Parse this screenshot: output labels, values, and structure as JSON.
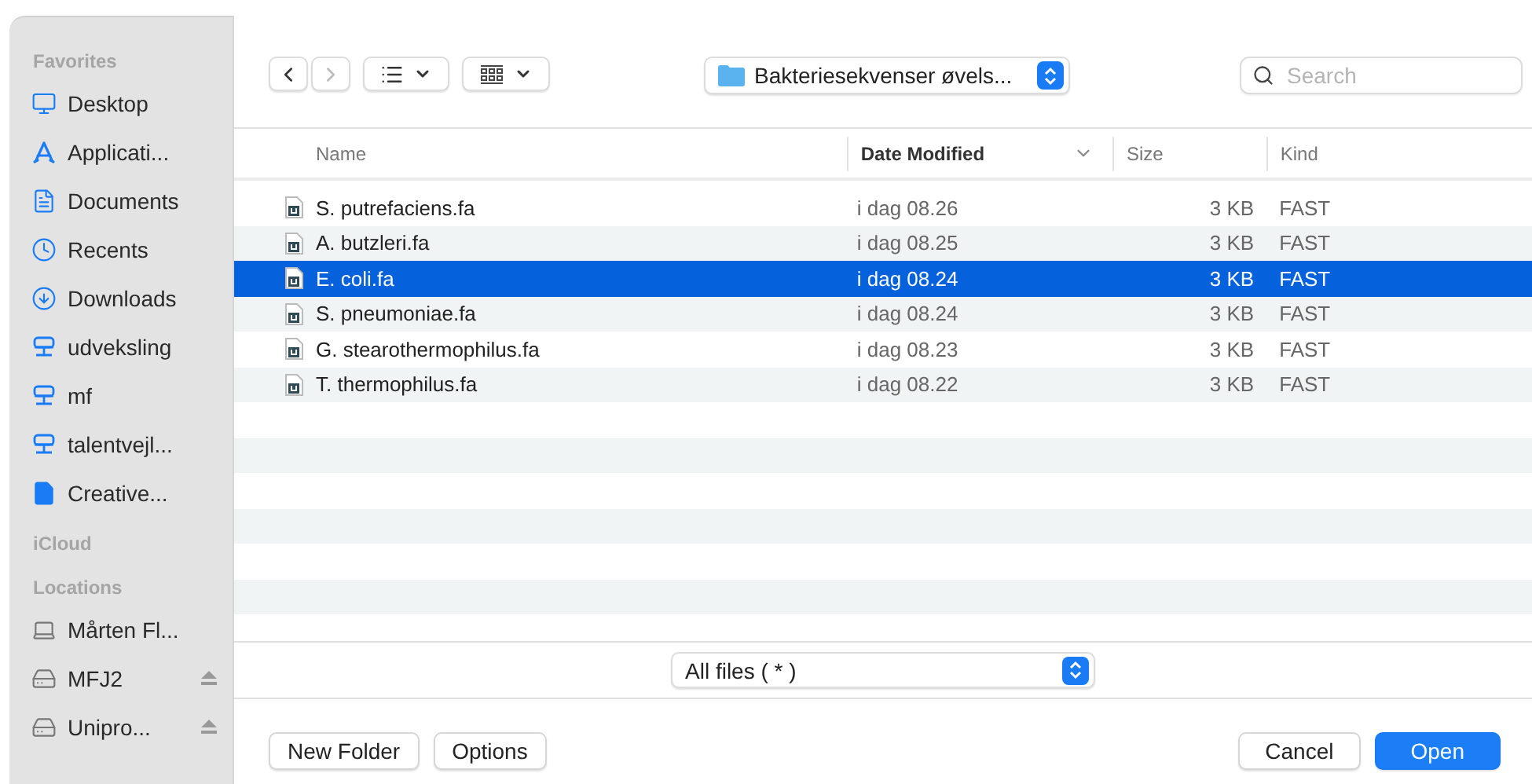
{
  "sidebar": {
    "sections": [
      {
        "title": "Favorites",
        "items": [
          {
            "label": "Desktop",
            "kind": "desktop"
          },
          {
            "label": "Applicati...",
            "kind": "apps"
          },
          {
            "label": "Documents",
            "kind": "document"
          },
          {
            "label": "Recents",
            "kind": "clock"
          },
          {
            "label": "Downloads",
            "kind": "download"
          },
          {
            "label": "udveksling",
            "kind": "server"
          },
          {
            "label": "mf",
            "kind": "server"
          },
          {
            "label": "talentvejl...",
            "kind": "server"
          },
          {
            "label": "Creative...",
            "kind": "file"
          }
        ]
      },
      {
        "title": "iCloud"
      },
      {
        "title": "Locations",
        "items": [
          {
            "label": "Mårten Fl...",
            "kind": "computer",
            "ejectable": false
          },
          {
            "label": "MFJ2",
            "kind": "disk",
            "ejectable": true
          },
          {
            "label": "Unipro...",
            "kind": "disk",
            "ejectable": true
          }
        ]
      }
    ]
  },
  "toolbar": {
    "location": "Bakteriesekvenser øvels...",
    "search": {
      "placeholder": "Search"
    }
  },
  "table": {
    "columns": [
      {
        "label": "Name",
        "sorted": false
      },
      {
        "label": "Date Modified",
        "sorted": true
      },
      {
        "label": "Size",
        "sorted": false
      },
      {
        "label": "Kind",
        "sorted": false
      }
    ],
    "rows": [
      {
        "name": "S. putrefaciens.fa",
        "date": "i dag 08.26",
        "size": "3 KB",
        "kind": "FAST",
        "selected": false
      },
      {
        "name": "A. butzleri.fa",
        "date": "i dag 08.25",
        "size": "3 KB",
        "kind": "FAST",
        "selected": false
      },
      {
        "name": "E. coli.fa",
        "date": "i dag 08.24",
        "size": "3 KB",
        "kind": "FAST",
        "selected": true
      },
      {
        "name": "S. pneumoniae.fa",
        "date": "i dag 08.24",
        "size": "3 KB",
        "kind": "FAST",
        "selected": false
      },
      {
        "name": "G. stearothermophilus.fa",
        "date": "i dag 08.23",
        "size": "3 KB",
        "kind": "FAST",
        "selected": false
      },
      {
        "name": "T. thermophilus.fa",
        "date": "i dag 08.22",
        "size": "3 KB",
        "kind": "FAST",
        "selected": false
      }
    ]
  },
  "filter": "All files ( * )",
  "buttons": {
    "left": [
      "New Folder",
      "Options"
    ],
    "cancel": "Cancel",
    "confirm": "Open"
  }
}
